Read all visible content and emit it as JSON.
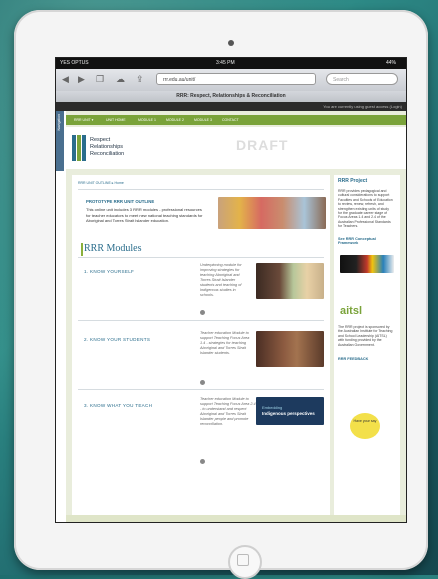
{
  "status_bar": {
    "carrier": "YES OPTUS",
    "time": "3:45 PM",
    "battery": "44%"
  },
  "browser": {
    "url": "rrr.edu.au/unit/",
    "search_placeholder": "Search",
    "page_title": "RRR: Respect, Relationships & Reconciliation",
    "login_notice": "You are currently using guest access (Login)"
  },
  "side_tab": {
    "label": "Navigation"
  },
  "nav": {
    "items": [
      "RRR UNIT ▾",
      "UNIT HOME",
      "MODULE 1",
      "MODULE 2",
      "MODULE 3",
      "CONTACT"
    ]
  },
  "header": {
    "logo_lines": [
      "Respect",
      "Relationships",
      "Reconciliation"
    ],
    "draft_label": "DRAFT"
  },
  "main": {
    "breadcrumb": "RRR UNIT OUTLINE ▸ Home",
    "prototype_title": "PROTOTYPE RRR UNIT OUTLINE",
    "prototype_text": "This online unit includes 3 RRR modules - professional resources for teacher educators to meet new national teaching standards for Aboriginal and Torres Strait Islander education.",
    "modules_heading": "RRR Modules",
    "modules": [
      {
        "title": "1. KNOW YOURSELF",
        "desc": "Underpinning module for improving strategies for teaching Aboriginal and Torres Strait Islander students and teaching of Indigenous studies in schools."
      },
      {
        "title": "2. KNOW YOUR STUDENTS",
        "desc": "Teacher education Module to support Teaching Focus Area 1.4 - strategies for teaching Aboriginal and Torres Strait Islander students."
      },
      {
        "title": "3. KNOW WHAT YOU TEACH",
        "desc": "Teacher education Module to support Teaching Focus Area 2.4 - to understand and respect Aboriginal and Torres Strait Islander people and promote reconciliation."
      }
    ],
    "embed_banner": {
      "line1": "Embedding",
      "line2": "Indigenous perspectives"
    }
  },
  "sidebar": {
    "title": "RRR Project",
    "intro": "RRR provides pedagogical and cultural considerations to support Faculties and Schools of Education to review, renew, refresh, and strengthen existing units of study for the graduate career stage of Focus Areas 1.4 and 2.4 of the Australian Professional Standards for Teachers.",
    "framework_link": "See RRR Conceptual Framework",
    "aitsl_label": "aitsl",
    "aitsl_text": "The RRR project is sponsored by the Australian Institute for Teaching and School Leadership (AITSL) with funding provided by the Australian Government.",
    "feedback_link": "RRR FEEDBACK",
    "bubble_text": "Have your say"
  },
  "colors": {
    "accent": "#2a6d8c",
    "nav_green": "#7aa33a",
    "bubble": "#f3e04a"
  }
}
